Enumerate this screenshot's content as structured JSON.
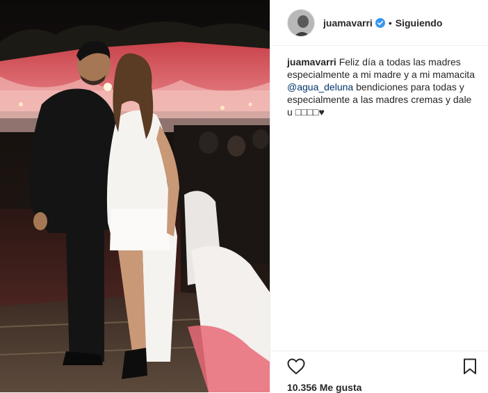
{
  "header": {
    "username": "juamavarri",
    "separator": "•",
    "follow_state": "Siguiendo",
    "verified_icon": "verified-badge-icon"
  },
  "caption": {
    "username": "juamavarri",
    "text_part1": "Feliz día a todas las madres especialmente a mi madre y a mi mamacita",
    "mention": "@agua_deluna",
    "text_part2": "bendiciones para todas y especialmente a las madres cremas y dale u",
    "trailing_glyphs": "□□□□",
    "heart": "♥"
  },
  "actions": {
    "like_icon": "heart-outline-icon",
    "save_icon": "bookmark-icon",
    "likes_text": "10.356 Me gusta"
  },
  "colors": {
    "text": "#262626",
    "mention": "#003569",
    "verified": "#3897f0",
    "divider": "#efefef"
  }
}
